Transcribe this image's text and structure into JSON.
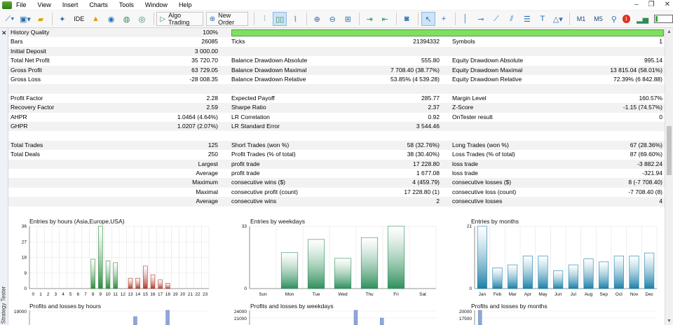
{
  "menu": {
    "items": [
      "File",
      "View",
      "Insert",
      "Charts",
      "Tools",
      "Window",
      "Help"
    ]
  },
  "toolbar": {
    "ide_label": "IDE",
    "algo_trading_label": "Algo Trading",
    "new_order_label": "New Order",
    "timeframes": [
      "M1",
      "M5"
    ],
    "notifications_count": "1"
  },
  "side_panel": {
    "label": "Strategy Tester"
  },
  "colors": {
    "quality_bar": "#7ee060",
    "hours_profit": "#2e8b3d",
    "hours_loss": "#b0382a",
    "weekdays_bar": "#2f8f5c",
    "months_bar": "#1a7fa8",
    "profit_loss_bar": "#8ea6d8"
  },
  "report": {
    "rows": [
      {
        "l1": "History Quality",
        "v1": "100%",
        "quality_bar": true
      },
      {
        "l1": "Bars",
        "v1": "26085",
        "l2": "Ticks",
        "v2": "21394332",
        "l3": "Symbols",
        "v3": "1"
      },
      {
        "l1": "Initial Deposit",
        "v1": "3 000.00"
      },
      {
        "l1": "Total Net Profit",
        "v1": "35 720.70",
        "l2": "Balance Drawdown Absolute",
        "v2": "555.80",
        "l3": "Equity Drawdown Absolute",
        "v3": "995.14"
      },
      {
        "l1": "Gross Profit",
        "v1": "63 729.05",
        "l2": "Balance Drawdown Maximal",
        "v2": "7 708.40 (38.77%)",
        "l3": "Equity Drawdown Maximal",
        "v3": "13 815.04 (58.01%)"
      },
      {
        "l1": "Gross Loss",
        "v1": "-28 008.35",
        "l2": "Balance Drawdown Relative",
        "v2": "53.85% (4 539.28)",
        "l3": "Equity Drawdown Relative",
        "v3": "72.39% (6 842.88)"
      },
      {},
      {
        "l1": "Profit Factor",
        "v1": "2.28",
        "l2": "Expected Payoff",
        "v2": "285.77",
        "l3": "Margin Level",
        "v3": "160.57%"
      },
      {
        "l1": "Recovery Factor",
        "v1": "2.59",
        "l2": "Sharpe Ratio",
        "v2": "2.37",
        "l3": "Z-Score",
        "v3": "-1.15 (74.57%)"
      },
      {
        "l1": "AHPR",
        "v1": "1.0464 (4.64%)",
        "l2": "LR Correlation",
        "v2": "0.92",
        "l3": "OnTester result",
        "v3": "0"
      },
      {
        "l1": "GHPR",
        "v1": "1.0207 (2.07%)",
        "l2": "LR Standard Error",
        "v2": "3 544.46"
      },
      {},
      {
        "l1": "Total Trades",
        "v1": "125",
        "l2": "Short Trades (won %)",
        "v2": "58 (32.76%)",
        "l3": "Long Trades (won %)",
        "v3": "67 (28.36%)"
      },
      {
        "l1": "Total Deals",
        "v1": "250",
        "l2": "Profit Trades (% of total)",
        "v2": "38 (30.40%)",
        "l3": "Loss Trades (% of total)",
        "v3": "87 (69.60%)"
      },
      {
        "v1": "Largest",
        "l2": "profit trade",
        "v2": "17 228.80",
        "l3": "loss trade",
        "v3": "-3 882.24"
      },
      {
        "v1": "Average",
        "l2": "profit trade",
        "v2": "1 677.08",
        "l3": "loss trade",
        "v3": "-321.94"
      },
      {
        "v1": "Maximum",
        "l2": "consecutive wins ($)",
        "v2": "4 (459.79)",
        "l3": "consecutive losses ($)",
        "v3": "8 (-7 708.40)"
      },
      {
        "v1": "Maximal",
        "l2": "consecutive profit (count)",
        "v2": "17 228.80 (1)",
        "l3": "consecutive loss (count)",
        "v3": "-7 708.40 (8)"
      },
      {
        "v1": "Average",
        "l2": "consecutive wins",
        "v2": "2",
        "l3": "consecutive losses",
        "v3": "4"
      }
    ]
  },
  "chart_data": [
    {
      "type": "bar",
      "title": "Entries by hours (Asia,Europe,USA)",
      "categories": [
        "0",
        "1",
        "2",
        "3",
        "4",
        "5",
        "6",
        "7",
        "8",
        "9",
        "10",
        "11",
        "12",
        "13",
        "14",
        "15",
        "16",
        "17",
        "18",
        "19",
        "20",
        "21",
        "22",
        "23"
      ],
      "series": [
        {
          "values": [
            0,
            0,
            0,
            0,
            0,
            0,
            0,
            0,
            17,
            36,
            16,
            15,
            0,
            0,
            0,
            0,
            0,
            0,
            0,
            0,
            0,
            0,
            0,
            0
          ]
        },
        {
          "values": [
            0,
            0,
            0,
            0,
            0,
            0,
            0,
            0,
            0,
            0,
            0,
            0,
            0,
            6,
            6,
            13,
            8,
            5,
            3,
            0,
            0,
            0,
            0,
            0
          ]
        }
      ],
      "yticks": [
        "0",
        "9",
        "18",
        "27",
        "36"
      ],
      "ylim": [
        0,
        36
      ]
    },
    {
      "type": "bar",
      "title": "Entries by weekdays",
      "categories": [
        "Sun",
        "Mon",
        "Tue",
        "Wed",
        "Thu",
        "Fri",
        "Sat"
      ],
      "values": [
        0,
        19,
        26,
        16,
        27,
        33,
        0
      ],
      "yticks": [
        "0",
        "33"
      ],
      "ylim": [
        0,
        33
      ]
    },
    {
      "type": "bar",
      "title": "Entries by months",
      "categories": [
        "Jan",
        "Feb",
        "Mar",
        "Apr",
        "May",
        "Jun",
        "Jul",
        "Aug",
        "Sep",
        "Oct",
        "Nov",
        "Dec"
      ],
      "values": [
        21,
        7,
        8,
        11,
        11,
        6,
        8,
        10,
        9,
        11,
        11,
        12
      ],
      "yticks": [
        "0",
        "21"
      ],
      "ylim": [
        0,
        21
      ]
    },
    {
      "type": "bar",
      "title": "Profits and losses by hours",
      "yticks": [
        "19000"
      ]
    },
    {
      "type": "bar",
      "title": "Profits and losses by weekdays",
      "yticks": [
        "24000",
        "21000"
      ]
    },
    {
      "type": "bar",
      "title": "Profits and losses by months",
      "yticks": [
        "20000",
        "17500"
      ]
    }
  ]
}
